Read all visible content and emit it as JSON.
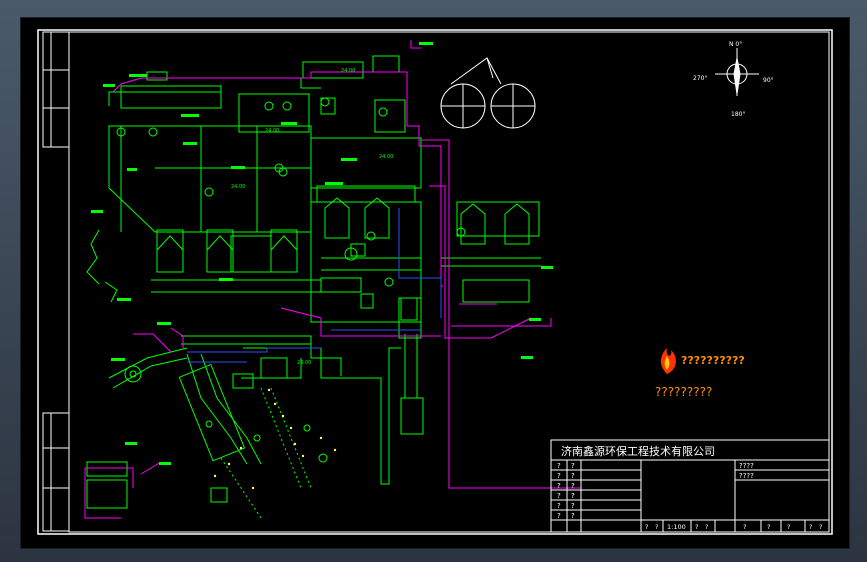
{
  "title_block": {
    "company": "济南鑫源环保工程技术有限公司",
    "cell_right_1": "????",
    "cell_right_2": "????",
    "bottom_row": [
      "?",
      "?",
      "1:100",
      "?",
      "?",
      "?",
      "?",
      "?",
      "?",
      "?"
    ]
  },
  "revision_rows": [
    [
      "?",
      "?"
    ],
    [
      "?",
      "?"
    ],
    [
      "?",
      "?"
    ],
    [
      "?",
      "?"
    ],
    [
      "?",
      "?"
    ],
    [
      "?",
      "?"
    ]
  ],
  "watermark": {
    "digits": "??????????",
    "subline": "?????????"
  },
  "compass": {
    "north": "N 0°",
    "east": "90°",
    "west": "270°",
    "south": "180°"
  },
  "labels": {
    "elev_a": "24.00",
    "elev_b": "24.00",
    "elev_c": "24.00",
    "elev_d": "24.00",
    "elev_e": "24.00"
  },
  "colors": {
    "frame": "#ffffff",
    "green": "#00ff00",
    "magenta": "#ff00ff",
    "blue": "#3050ff",
    "yellow": "#ffff00",
    "orange": "#ff8c00"
  }
}
